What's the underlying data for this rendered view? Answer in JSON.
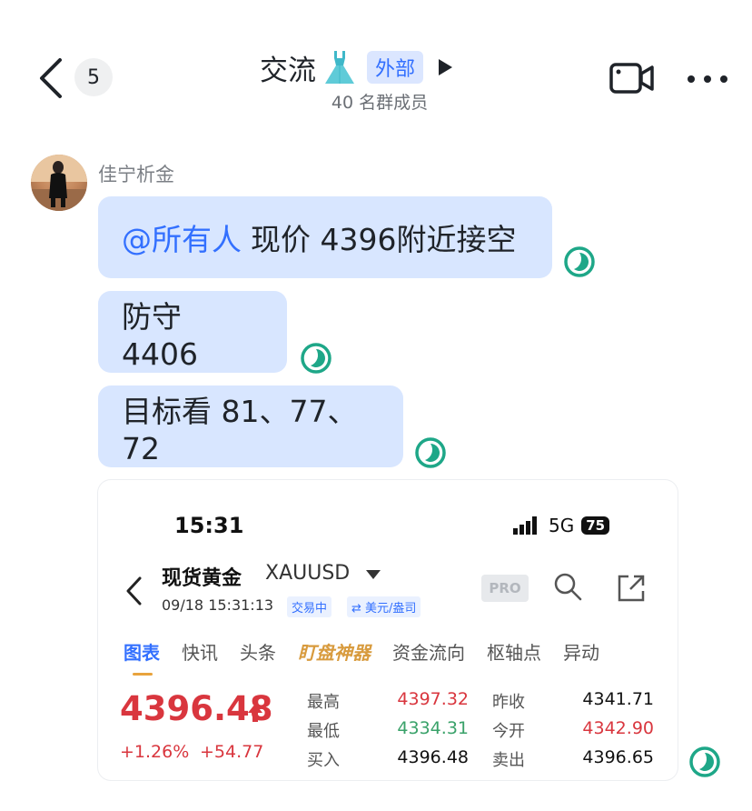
{
  "header": {
    "back_badge": "5",
    "title": "交流",
    "title_emoji": "dress-icon",
    "external_tag": "外部",
    "members": "40 名群成员",
    "icons": [
      "back-icon",
      "dress-icon",
      "play-icon",
      "video-call-icon",
      "more-icon"
    ]
  },
  "chat": {
    "sender": "佳宁析金",
    "messages": [
      {
        "mention": "@所有人",
        "text": "现价 4396附近接空"
      },
      {
        "text": "防守 4406"
      },
      {
        "text": "目标看 81、77、72"
      }
    ],
    "read_status_color": "#1ea788"
  },
  "quote_card": {
    "status_time": "15:31",
    "network": "5G",
    "battery": "75",
    "instrument_name": "现货黄金",
    "instrument_code": "XAUUSD",
    "datetime": "09/18 15:31:13",
    "tags": [
      "交易中",
      "⇄ 美元/盎司"
    ],
    "pro_badge": "PRO",
    "tabs": [
      "图表",
      "快讯",
      "头条",
      "盯盘神器",
      "资金流向",
      "枢轴点",
      "异动"
    ],
    "active_tab": "图表",
    "price": "4396.48",
    "change_pct": "+1.26%",
    "change_abs": "+54.77",
    "quotes": [
      {
        "label": "最高",
        "value": "4397.32",
        "label2": "昨收",
        "value2": "4341.71"
      },
      {
        "label": "最低",
        "value": "4334.31",
        "label2": "今开",
        "value2": "4342.90"
      },
      {
        "label": "买入",
        "value": "4396.48",
        "label2": "卖出",
        "value2": "4396.65"
      }
    ],
    "colors": {
      "up": "#d9363e",
      "down": "#3aa26a",
      "accent": "#3370ff"
    }
  }
}
